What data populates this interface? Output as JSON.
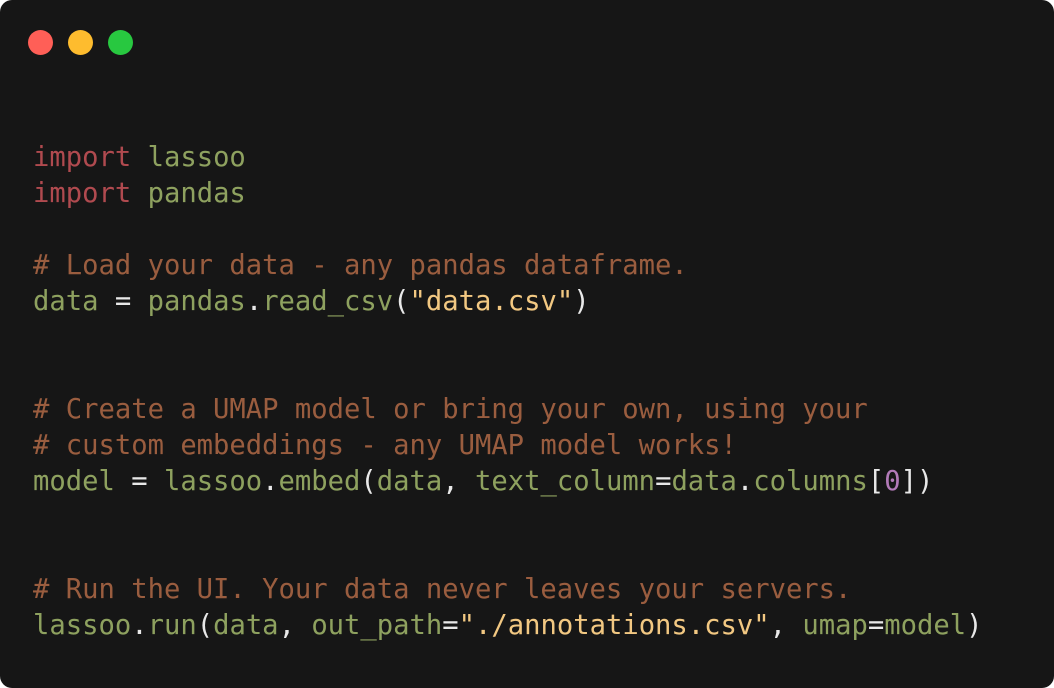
{
  "window": {
    "traffic_lights": [
      {
        "name": "close",
        "color": "#ff5f57"
      },
      {
        "name": "minimize",
        "color": "#febc2e"
      },
      {
        "name": "zoom",
        "color": "#28c840"
      }
    ],
    "background_color": "#161616"
  },
  "syntax_colors": {
    "keyword": "#b04a4f",
    "identifier": "#8ea15f",
    "comment": "#9a5d3f",
    "string": "#f2c882",
    "punctuation": "#e8e8e8",
    "number": "#b27ab8"
  },
  "code": [
    [
      {
        "t": "kw",
        "text": "import"
      },
      {
        "t": "pun",
        "text": " "
      },
      {
        "t": "id",
        "text": "lassoo"
      }
    ],
    [
      {
        "t": "kw",
        "text": "import"
      },
      {
        "t": "pun",
        "text": " "
      },
      {
        "t": "id",
        "text": "pandas"
      }
    ],
    [],
    [
      {
        "t": "cm",
        "text": "# Load your data - any pandas dataframe."
      }
    ],
    [
      {
        "t": "id",
        "text": "data"
      },
      {
        "t": "pun",
        "text": " = "
      },
      {
        "t": "id",
        "text": "pandas"
      },
      {
        "t": "pun",
        "text": "."
      },
      {
        "t": "id",
        "text": "read_csv"
      },
      {
        "t": "pun",
        "text": "("
      },
      {
        "t": "str",
        "text": "\"data.csv\""
      },
      {
        "t": "pun",
        "text": ")"
      }
    ],
    [],
    [],
    [
      {
        "t": "cm",
        "text": "# Create a UMAP model or bring your own, using your"
      }
    ],
    [
      {
        "t": "cm",
        "text": "# custom embeddings - any UMAP model works!"
      }
    ],
    [
      {
        "t": "id",
        "text": "model"
      },
      {
        "t": "pun",
        "text": " = "
      },
      {
        "t": "id",
        "text": "lassoo"
      },
      {
        "t": "pun",
        "text": "."
      },
      {
        "t": "id",
        "text": "embed"
      },
      {
        "t": "pun",
        "text": "("
      },
      {
        "t": "id",
        "text": "data"
      },
      {
        "t": "pun",
        "text": ", "
      },
      {
        "t": "id",
        "text": "text_column"
      },
      {
        "t": "pun",
        "text": "="
      },
      {
        "t": "id",
        "text": "data"
      },
      {
        "t": "pun",
        "text": "."
      },
      {
        "t": "id",
        "text": "columns"
      },
      {
        "t": "pun",
        "text": "["
      },
      {
        "t": "num",
        "text": "0"
      },
      {
        "t": "pun",
        "text": "])"
      }
    ],
    [],
    [],
    [
      {
        "t": "cm",
        "text": "# Run the UI. Your data never leaves your servers."
      }
    ],
    [
      {
        "t": "id",
        "text": "lassoo"
      },
      {
        "t": "pun",
        "text": "."
      },
      {
        "t": "id",
        "text": "run"
      },
      {
        "t": "pun",
        "text": "("
      },
      {
        "t": "id",
        "text": "data"
      },
      {
        "t": "pun",
        "text": ", "
      },
      {
        "t": "id",
        "text": "out_path"
      },
      {
        "t": "pun",
        "text": "="
      },
      {
        "t": "str",
        "text": "\"./annotations.csv\""
      },
      {
        "t": "pun",
        "text": ", "
      },
      {
        "t": "id",
        "text": "umap"
      },
      {
        "t": "pun",
        "text": "="
      },
      {
        "t": "id",
        "text": "model"
      },
      {
        "t": "pun",
        "text": ")"
      }
    ]
  ]
}
